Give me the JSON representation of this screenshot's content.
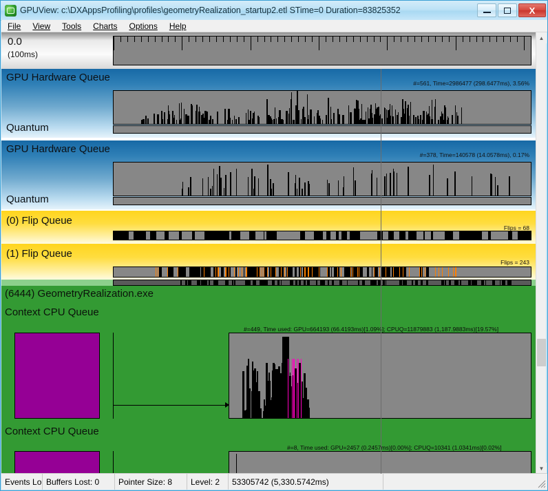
{
  "window": {
    "title": "GPUView: c:\\DXAppsProfiling\\profiles\\geometryRealization_startup2.etl STime=0 Duration=83825352",
    "minimize_label": "",
    "maximize_label": "",
    "close_label": "X"
  },
  "menu": {
    "items": [
      {
        "label": "File",
        "accel": "F"
      },
      {
        "label": "View",
        "accel": "V"
      },
      {
        "label": "Tools",
        "accel": "T"
      },
      {
        "label": "Charts",
        "accel": "C"
      },
      {
        "label": "Options",
        "accel": "O"
      },
      {
        "label": "Help",
        "accel": "H"
      }
    ]
  },
  "ruler": {
    "start_label": "0.0",
    "unit_label": "(100ms)"
  },
  "rows": [
    {
      "id": "gpu-hw-queue-0",
      "title": "GPU Hardware Queue",
      "stat": "#=561,  Time=2986477 (298.6477ms),  3.56%",
      "sub_title": "Quantum",
      "kind": "hardware-queue"
    },
    {
      "id": "gpu-hw-queue-1",
      "title": "GPU Hardware Queue",
      "stat": "#=378,  Time=140578 (14.0578ms),  0.17%",
      "sub_title": "Quantum",
      "kind": "hardware-queue"
    },
    {
      "id": "flip-queue-0",
      "title": "(0) Flip Queue",
      "stat": "Flips = 68",
      "kind": "flip-queue"
    },
    {
      "id": "flip-queue-1",
      "title": "(1) Flip Queue",
      "stat": "Flips = 243",
      "kind": "flip-queue"
    }
  ],
  "process": {
    "title": "(6444) GeometryRealization.exe",
    "contexts": [
      {
        "title": "Context CPU Queue",
        "stat": "#=449, Time used: GPU=664193 (66.4193ms)[1.09%]; CPUQ=11879883 (1,187.9883ms)[19.57%]"
      },
      {
        "title": "Context CPU Queue",
        "stat": "#=8, Time used: GPU=2457 (0.2457ms)[0.00%]; CPUQ=10341 (1.0341ms)[0.02%]"
      }
    ]
  },
  "statusbar": {
    "cells": [
      "Events Lo",
      "Buffers Lost: 0",
      "Pointer Size: 8",
      "Level: 2",
      "53305742 (5,330.5742ms)",
      ""
    ]
  },
  "scrollbar": {
    "up_arrow": "▲",
    "down_arrow": "▼"
  },
  "colors": {
    "header_blue": "#1769a6",
    "flip_yellow": "#ffd51e",
    "process_green": "#339a33",
    "purple_block": "#950095",
    "track_gray": "#878787",
    "event_black": "#000000",
    "flip_orange": "#ff8000",
    "present_magenta": "#ff00c0",
    "titlebar_blue": "#bde2f6"
  }
}
